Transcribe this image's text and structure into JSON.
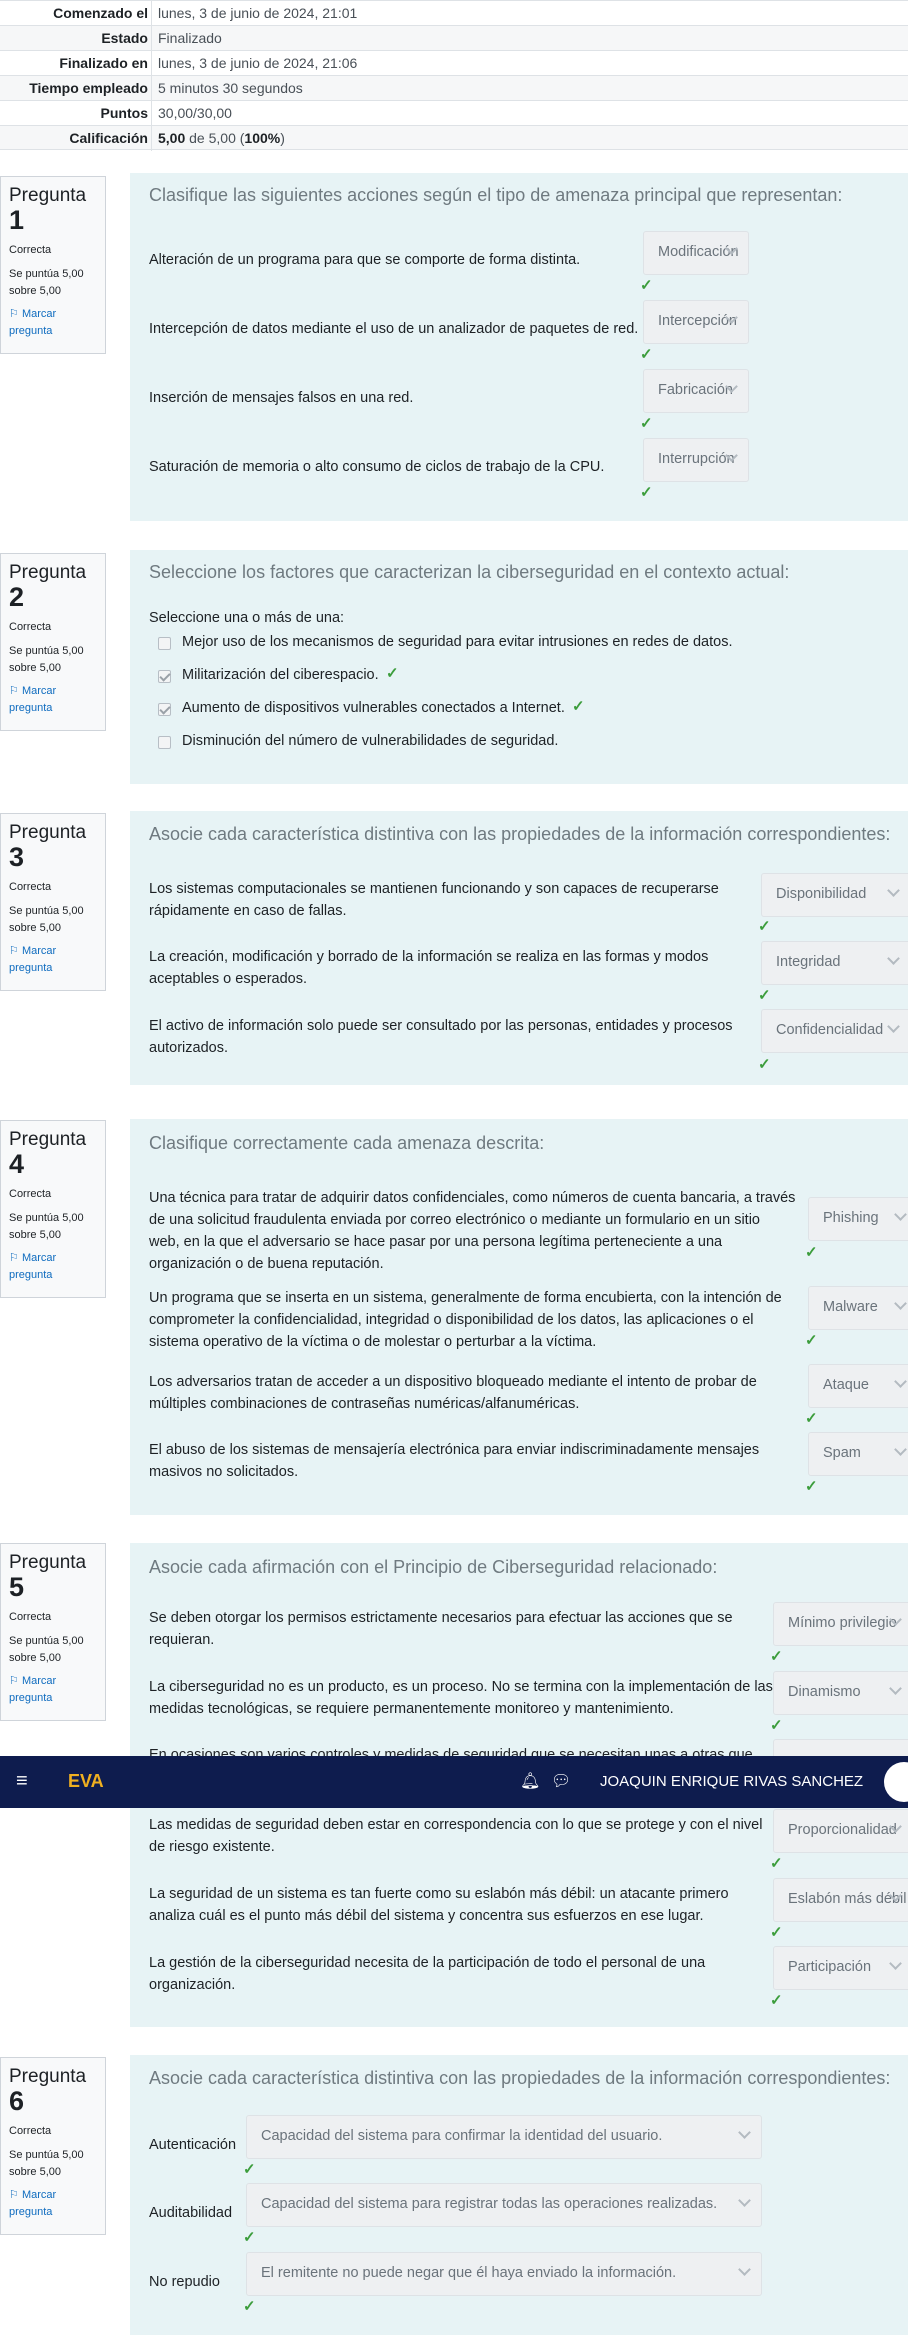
{
  "summary": [
    {
      "key": "Comenzado el",
      "value": "lunes, 3 de junio de 2024, 21:01"
    },
    {
      "key": "Estado",
      "value": "Finalizado"
    },
    {
      "key": "Finalizado en",
      "value": "lunes, 3 de junio de 2024, 21:06"
    },
    {
      "key": "Tiempo empleado",
      "value": "5 minutos 30 segundos"
    },
    {
      "key": "Puntos",
      "value": "30,00/30,00"
    },
    {
      "key": "Calificación",
      "value_bold": "5,00",
      "value_mid": " de 5,00 (",
      "value_pct": "100%",
      "value_end": ")"
    }
  ],
  "info_common": {
    "question_word": "Pregunta",
    "state": "Correcta",
    "grade_line1": "Se puntúa 5,00",
    "grade_line2": "sobre 5,00",
    "flag_line1": "Marcar",
    "flag_line2": "pregunta"
  },
  "q1": {
    "number": "1",
    "text": "Clasifique las siguientes acciones según el tipo de amenaza principal que representan:",
    "items": [
      {
        "stem": "Alteración de un programa para que se comporte de forma distinta.",
        "answer": "Modificación"
      },
      {
        "stem": "Intercepción de datos mediante el uso de un analizador de paquetes de red.",
        "answer": "Intercepción"
      },
      {
        "stem": "Inserción de mensajes falsos en una red.",
        "answer": "Fabricación"
      },
      {
        "stem": "Saturación de memoria o alto consumo de ciclos de trabajo de la CPU.",
        "answer": "Interrupción"
      }
    ]
  },
  "q2": {
    "number": "2",
    "text": "Seleccione los factores que caracterizan la ciberseguridad en el contexto actual:",
    "prompt": "Seleccione una o más de una:",
    "options": [
      {
        "label": "Mejor uso de los mecanismos de seguridad para evitar intrusiones en redes de datos."
      },
      {
        "label": "Militarización del ciberespacio."
      },
      {
        "label": "Aumento de dispositivos vulnerables conectados a Internet."
      },
      {
        "label": "Disminución del número de vulnerabilidades de seguridad."
      }
    ]
  },
  "q3": {
    "number": "3",
    "text": "Asocie cada característica distintiva con las propiedades de la información correspondientes:",
    "items": [
      {
        "stem1": "Los sistemas computacionales se mantienen funcionando y son capaces de recuperarse",
        "stem2": "rápidamente en caso de fallas.",
        "answer": "Disponibilidad"
      },
      {
        "stem1": "La creación, modificación y borrado de la información se realiza en las formas y modos",
        "stem2": "aceptables o esperados.",
        "answer": "Integridad"
      },
      {
        "stem1": "El activo de información solo puede ser consultado por las personas, entidades y procesos",
        "stem2": "autorizados.",
        "answer": "Confidencialidad"
      }
    ]
  },
  "q4": {
    "number": "4",
    "text": "Clasifique correctamente cada amenaza descrita:",
    "items": [
      {
        "l1": "Una técnica para tratar de adquirir datos confidenciales, como números de cuenta bancaria, a través",
        "l2": "de una solicitud fraudulenta enviada por correo electrónico o mediante un formulario en un sitio",
        "l3": "web, en la que el adversario se hace pasar por una persona legítima perteneciente a una",
        "l4": "organización o de buena reputación.",
        "answer": "Phishing"
      },
      {
        "l1": "Un programa que se inserta en un sistema, generalmente de forma encubierta, con la intención de",
        "l2": "comprometer la confidencialidad, integridad o disponibilidad de los datos, las aplicaciones o el",
        "l3": "sistema operativo de la víctima o de molestar o perturbar a la víctima.",
        "answer": "Malware"
      },
      {
        "l1": "Los adversarios tratan de acceder a un dispositivo bloqueado mediante el intento de probar de",
        "l2": "múltiples combinaciones de contraseñas numéricas/alfanuméricas.",
        "answer": "Ataque"
      },
      {
        "l1": "El abuso de los sistemas de mensajería electrónica para enviar indiscriminadamente mensajes",
        "l2": "masivos no solicitados.",
        "answer": "Spam"
      }
    ]
  },
  "q5": {
    "number": "5",
    "text": "Asocie cada afirmación con el Principio de Ciberseguridad relacionado:",
    "items": [
      {
        "l1": "Se deben otorgar los permisos estrictamente necesarios para efectuar las acciones que se",
        "l2": "requieran.",
        "answer": "Mínimo privilegio"
      },
      {
        "l1": "La ciberseguridad no es un producto, es un proceso. No se termina con la implementación de las",
        "l2": "medidas tecnológicas, se requiere permanentemente monitoreo y mantenimiento.",
        "answer": "Dinamismo"
      },
      {
        "l1": "En ocasiones son varios controles y medidas de seguridad que se necesitan unas a otras que",
        "l2": "",
        "answer": ""
      },
      {
        "l1": "Las medidas de seguridad deben estar en correspondencia con lo que se protege y con el nivel",
        "l2": "de riesgo existente.",
        "answer": "Proporcionalidad"
      },
      {
        "l1": "La seguridad de un sistema es tan fuerte como su eslabón más débil: un atacante primero",
        "l2": "analiza cuál es el punto más débil del sistema y concentra sus esfuerzos en ese lugar.",
        "answer": "Eslabón más débil"
      },
      {
        "l1": "La gestión de la ciberseguridad necesita de la participación de todo el personal de una",
        "l2": "organización.",
        "answer": "Participación"
      }
    ]
  },
  "q6": {
    "number": "6",
    "text": "Asocie cada característica distintiva con las propiedades de la información correspondientes:",
    "items": [
      {
        "stem": "Autenticación",
        "answer": "Capacidad del sistema para confirmar la identidad del usuario."
      },
      {
        "stem": "Auditabilidad",
        "answer": "Capacidad del sistema para registrar todas las operaciones realizadas."
      },
      {
        "stem": "No repudio",
        "answer": "El remitente no puede negar que él haya enviado la información."
      }
    ]
  },
  "navbar": {
    "brand": "EVA",
    "menu_icon": "hamburger-icon",
    "bell_icon": "bell-icon",
    "chat_icon": "chat-icon",
    "user": "JOAQUIN ENRIQUE RIVAS SANCHEZ"
  },
  "colors": {
    "check": "#3c9d3c",
    "navbar": "#0e1c4e",
    "brand": "#f0b020",
    "content_bg": "#e7f3f5"
  }
}
